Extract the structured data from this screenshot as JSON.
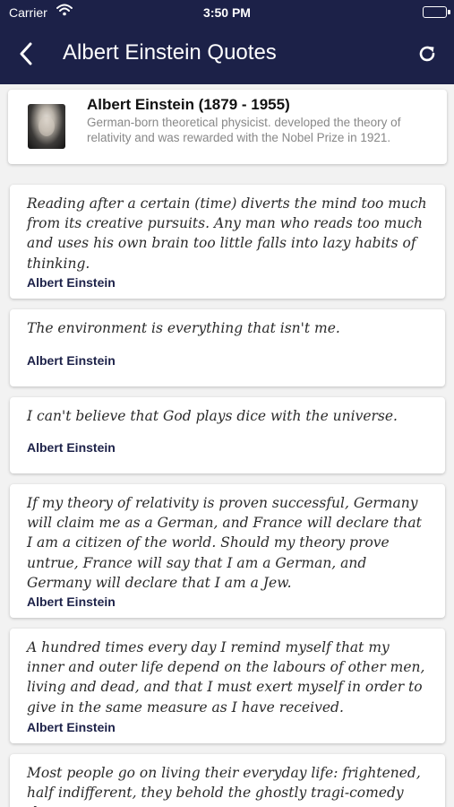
{
  "status_bar": {
    "carrier": "Carrier",
    "time": "3:50 PM"
  },
  "nav": {
    "title": "Albert Einstein Quotes",
    "back_icon": "chevron-left-icon",
    "refresh_icon": "refresh-icon"
  },
  "author": {
    "name": "Albert Einstein (1879 - 1955)",
    "bio": "German-born theoretical physicist.  developed the theory of relativity and was rewarded with the Nobel Prize in 1921."
  },
  "quotes": [
    {
      "text": "Reading after a certain (time) diverts the mind too much from its creative pursuits. Any man who reads too much and uses his own brain too little falls into lazy habits of thinking.",
      "author": "Albert Einstein"
    },
    {
      "text": "The environment is everything that isn't me.",
      "author": "Albert Einstein"
    },
    {
      "text": "I can't believe that God plays dice with the universe.",
      "author": "Albert Einstein"
    },
    {
      "text": "If my theory of relativity is proven successful, Germany will claim me as a German, and France will declare that I am a citizen of the world. Should my theory prove untrue, France will say that I am a German, and Germany will declare that I am a Jew.",
      "author": "Albert Einstein"
    },
    {
      "text": "A hundred times every day I remind myself that my inner and outer life depend on the labours of other men, living and dead, and that I must exert myself in order to give in the same measure as I have received.",
      "author": "Albert Einstein"
    },
    {
      "text": "Most people go on living their everyday life: frightened, half indifferent, they behold the ghostly tragi-comedy that",
      "author": ""
    }
  ],
  "colors": {
    "nav_background": "#1c2148",
    "author_text": "#1c2148",
    "page_background": "#f2f2f2"
  }
}
